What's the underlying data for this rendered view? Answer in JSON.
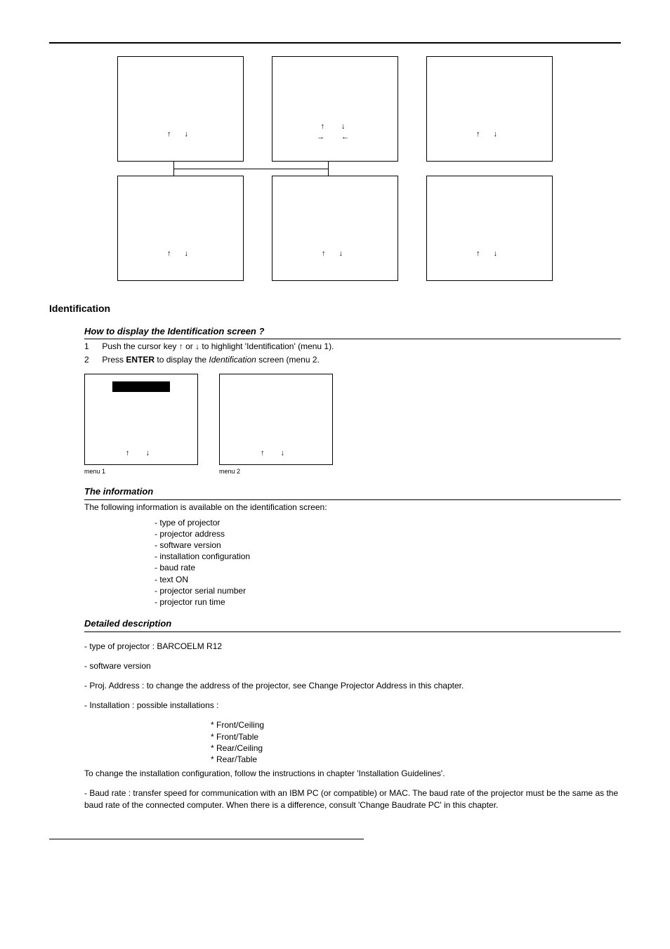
{
  "arrows": {
    "ud": "↑   ↓",
    "udlr": "↑  ↓\n→  ←"
  },
  "captions": {
    "menu1": "menu 1",
    "menu2": "menu 2"
  },
  "section1": {
    "title": "Identification",
    "sub1": "How to display the Identification screen ?",
    "step1_num": "1",
    "step1_a": "Push the cursor key ",
    "step1_b": " or ",
    "step1_c": " to highlight 'Identification' (menu 1).",
    "step2_num": "2",
    "step2_a": "Press ",
    "step2_enter": "ENTER",
    "step2_b": " to display the ",
    "step2_ident": "Identification",
    "step2_c": " screen (menu 2.",
    "sub2": "The information",
    "info_intro": "The following information is available on the identification screen:",
    "info_items": [
      "type of projector",
      "projector address",
      "software version",
      "installation configuration",
      "baud rate",
      "text ON",
      "projector serial number",
      "projector run time"
    ],
    "sub3": "Detailed description",
    "d1": "- type of projector : BARCOELM R12",
    "d2": "-  software  version",
    "d3": "- Proj. Address : to change the address of the projector, see Change Projector Address in this chapter.",
    "d4": "- Installation : possible installations :",
    "install_items": [
      "Front/Ceiling",
      "Front/Table",
      "Rear/Ceiling",
      "Rear/Table"
    ],
    "d5": "To change the installation configuration, follow the instructions in chapter 'Installation Guidelines'.",
    "d6": "- Baud rate : transfer speed for communication with an IBM PC (or compatible) or MAC.  The baud rate of the projector must be the same as the baud rate of the connected computer. When there is a difference, consult 'Change Baudrate PC' in this chapter."
  }
}
